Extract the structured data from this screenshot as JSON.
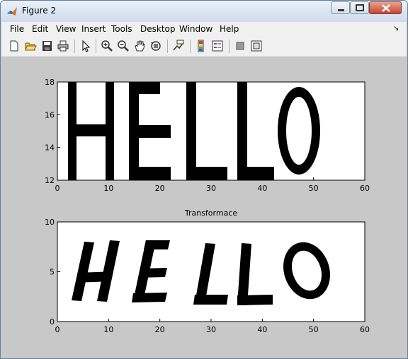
{
  "window": {
    "title": "Figure 2",
    "menu": [
      "File",
      "Edit",
      "View",
      "Insert",
      "Tools",
      "Desktop",
      "Window",
      "Help"
    ]
  },
  "toolbar": {
    "icons": [
      "new-figure-icon",
      "open-file-icon",
      "save-icon",
      "print-icon",
      "edit-plot-arrow-icon",
      "zoom-in-icon",
      "zoom-out-icon",
      "pan-hand-icon",
      "rotate-3d-icon",
      "data-cursor-icon",
      "insert-colorbar-icon",
      "insert-legend-icon",
      "hide-plot-tools-icon",
      "show-plot-tools-icon"
    ]
  },
  "chart_data": [
    {
      "type": "image",
      "title": "",
      "text_shown": "HELLO",
      "xlim": [
        0,
        60
      ],
      "ylim": [
        12,
        18
      ],
      "xticks": [
        "0",
        "10",
        "20",
        "30",
        "40",
        "50",
        "60"
      ],
      "yticks": [
        "12",
        "14",
        "16",
        "18"
      ]
    },
    {
      "type": "image",
      "title": "Transformace",
      "text_shown": "HELLO",
      "xlim": [
        0,
        60
      ],
      "ylim": [
        0,
        10
      ],
      "xticks": [
        "0",
        "10",
        "20",
        "30",
        "40",
        "50",
        "60"
      ],
      "yticks": [
        "0",
        "5",
        "10"
      ]
    }
  ]
}
